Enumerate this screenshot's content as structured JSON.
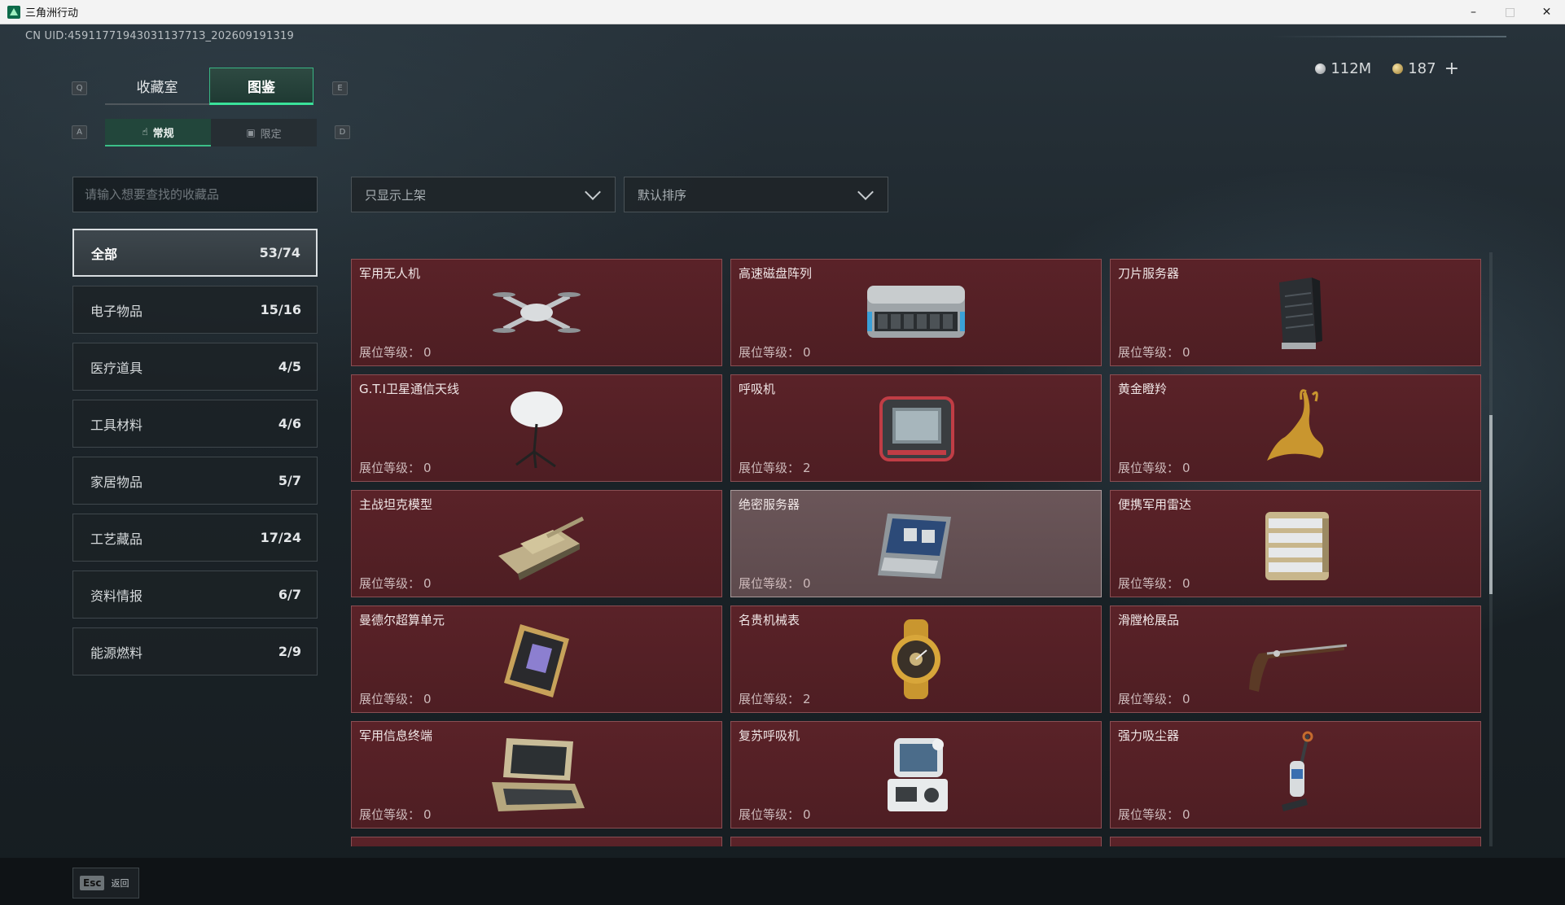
{
  "window": {
    "title": "三角洲行动",
    "minimize": "–",
    "maximize": "□",
    "close": "✕"
  },
  "uid": "CN UID:4591177194303113771З_202609191319",
  "currency": {
    "silver": "112M",
    "gold": "187",
    "add": "+"
  },
  "keys": {
    "prev_tab": "Q",
    "next_tab": "E",
    "prev_sub": "A",
    "next_sub": "D",
    "back": "Esc"
  },
  "main_tabs": [
    {
      "label": "收藏室",
      "active": false
    },
    {
      "label": "图鉴",
      "active": true
    }
  ],
  "sub_tabs": [
    {
      "label": "常规",
      "icon": "hand-icon",
      "active": true
    },
    {
      "label": "限定",
      "icon": "image-icon",
      "active": false
    }
  ],
  "search": {
    "placeholder": "请输入想要查找的收藏品"
  },
  "filters": {
    "display": "只显示上架",
    "sort": "默认排序"
  },
  "categories": [
    {
      "name": "全部",
      "count": "53/74",
      "active": true
    },
    {
      "name": "电子物品",
      "count": "15/16"
    },
    {
      "name": "医疗道具",
      "count": "4/5"
    },
    {
      "name": "工具材料",
      "count": "4/6"
    },
    {
      "name": "家居物品",
      "count": "5/7"
    },
    {
      "name": "工艺藏品",
      "count": "17/24"
    },
    {
      "name": "资料情报",
      "count": "6/7"
    },
    {
      "name": "能源燃料",
      "count": "2/9"
    }
  ],
  "level_label": "展位等级：",
  "items": [
    {
      "name": "军用无人机",
      "level": "0",
      "icon": "drone-icon"
    },
    {
      "name": "高速磁盘阵列",
      "level": "0",
      "icon": "disk-array-icon"
    },
    {
      "name": "刀片服务器",
      "level": "0",
      "icon": "blade-server-icon"
    },
    {
      "name": "G.T.I卫星通信天线",
      "level": "0",
      "icon": "satellite-dish-icon"
    },
    {
      "name": "呼吸机",
      "level": "2",
      "icon": "ventilator-icon"
    },
    {
      "name": "黄金瞪羚",
      "level": "0",
      "icon": "golden-gazelle-icon"
    },
    {
      "name": "主战坦克模型",
      "level": "0",
      "icon": "tank-model-icon"
    },
    {
      "name": "绝密服务器",
      "level": "0",
      "icon": "secret-server-icon"
    },
    {
      "name": "便携军用雷达",
      "level": "0",
      "icon": "portable-radar-icon"
    },
    {
      "name": "曼德尔超算单元",
      "level": "0",
      "icon": "supercompute-unit-icon"
    },
    {
      "name": "名贵机械表",
      "level": "2",
      "icon": "luxury-watch-icon"
    },
    {
      "name": "滑膛枪展品",
      "level": "0",
      "icon": "musket-icon"
    },
    {
      "name": "军用信息终端",
      "level": "0",
      "icon": "military-terminal-icon"
    },
    {
      "name": "复苏呼吸机",
      "level": "0",
      "icon": "resuscitator-icon"
    },
    {
      "name": "强力吸尘器",
      "level": "0",
      "icon": "vacuum-cleaner-icon"
    },
    {
      "name": "",
      "level": "",
      "icon": ""
    },
    {
      "name": "",
      "level": "",
      "icon": ""
    },
    {
      "name": "",
      "level": "",
      "icon": ""
    }
  ],
  "back_label": "返回",
  "colors": {
    "accent_green": "#3ae29a",
    "card_bg": "#5a2228",
    "card_border": "#8a4e53"
  }
}
